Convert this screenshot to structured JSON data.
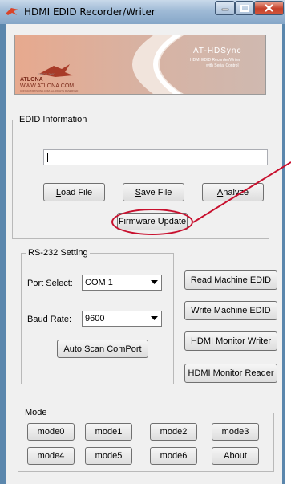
{
  "window": {
    "title": "HDMI EDID Recorder/Writer"
  },
  "logo": {
    "product": "AT-HDSync",
    "subtitle_line1": "HDMI EDID Recorder/Writer",
    "subtitle_line2": "with Serial Control",
    "brand": "ATLONA",
    "url": "WWW.ATLONA.COM",
    "since": "SINCE 2007",
    "tagline": "CONTACT@ATLONA.COM  ALL RIGHTS RESERVED"
  },
  "edid": {
    "label": "EDID Information",
    "path_value": "",
    "load_prefix": "L",
    "load_rest": "oad File",
    "save_prefix": "S",
    "save_rest": "ave File",
    "analyze_prefix": "A",
    "analyze_rest": "nalyze",
    "firmware_label": "Firmware Update"
  },
  "rs232": {
    "label": "RS-232 Setting",
    "port_label": "Port Select:",
    "port_value": "COM 1",
    "baud_label": "Baud Rate:",
    "baud_value": "9600",
    "auto_scan_label": "Auto Scan ComPort"
  },
  "machine": {
    "read_label": "Read Machine EDID",
    "write_label": "Write Machine EDID",
    "monitor_writer_label": "HDMI Monitor Writer",
    "monitor_reader_label": "HDMI Monitor Reader"
  },
  "mode": {
    "label": "Mode",
    "buttons": [
      "mode0",
      "mode1",
      "mode2",
      "mode3",
      "mode4",
      "mode5",
      "mode6",
      "About"
    ]
  },
  "colors": {
    "annotation": "#c8102e",
    "logo_accent": "#e2582a",
    "title_gradient_top": "#c9d9ea",
    "close_button": "#c5402a"
  }
}
